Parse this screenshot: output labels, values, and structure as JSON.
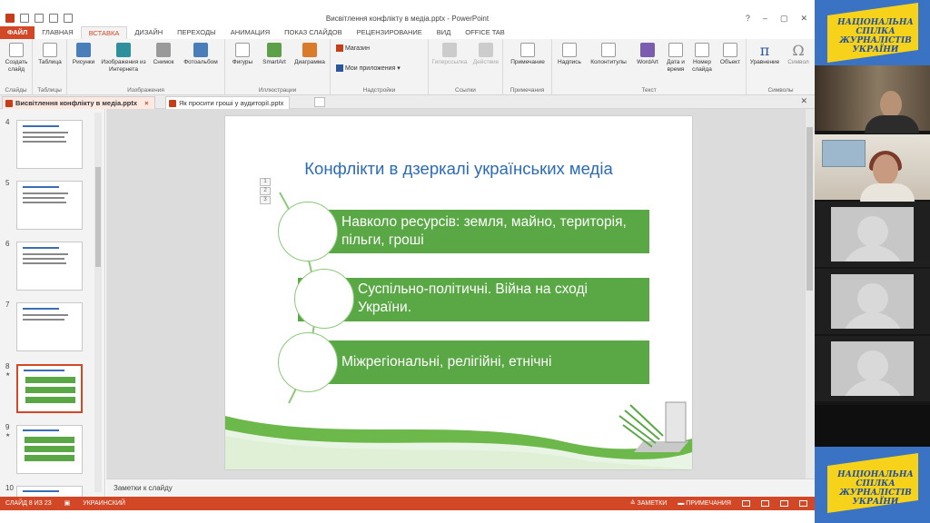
{
  "window": {
    "title": "Висвітлення конфлікту в медіа.pptx - PowerPoint"
  },
  "ribbon_tabs": [
    {
      "label": "ФАЙЛ"
    },
    {
      "label": "ГЛАВНАЯ"
    },
    {
      "label": "ВСТАВКА"
    },
    {
      "label": "ДИЗАЙН"
    },
    {
      "label": "ПЕРЕХОДЫ"
    },
    {
      "label": "АНИМАЦИЯ"
    },
    {
      "label": "ПОКАЗ СЛАЙДОВ"
    },
    {
      "label": "РЕЦЕНЗИРОВАНИЕ"
    },
    {
      "label": "ВИД"
    },
    {
      "label": "OFFICE TAB"
    }
  ],
  "ribbon": {
    "new_slide": "Создать слайд",
    "table": "Таблица",
    "pictures": "Рисунки",
    "online_pictures": "Изображения из Интернета",
    "screenshot": "Снимок",
    "photo_album": "Фотоальбом",
    "shapes": "Фигуры",
    "smartart": "SmartArt",
    "chart": "Диаграмма",
    "store": "Магазин",
    "my_apps": "Мои приложения",
    "hyperlink": "Гиперссылка",
    "action": "Действие",
    "comment": "Примечание",
    "textbox": "Надпись",
    "header_footer": "Колонтитулы",
    "wordart": "WordArt",
    "date_time": "Дата и время",
    "slide_number": "Номер слайда",
    "object": "Объект",
    "equation": "Уравнение",
    "symbol": "Символ",
    "groups": {
      "slides": "Слайды",
      "tables": "Таблицы",
      "images": "Изображения",
      "illustrations": "Иллюстрации",
      "addins": "Надстройки",
      "links": "Ссылки",
      "comments": "Примечания",
      "text": "Текст",
      "symbols": "Символы"
    }
  },
  "doc_tabs": [
    {
      "label": "Висвітлення конфлікту в медіа.pptx"
    },
    {
      "label": "Як просити гроші у аудиторії.pptx"
    }
  ],
  "thumbnails": [
    {
      "number": "4"
    },
    {
      "number": "5"
    },
    {
      "number": "6"
    },
    {
      "number": "7"
    },
    {
      "number": "8"
    },
    {
      "number": "9"
    },
    {
      "number": "10"
    }
  ],
  "slide": {
    "title": "Конфлікти в дзеркалі українських медіа",
    "items": [
      {
        "text": "Навколо ресурсів: земля, майно, територія, пільги, гроші"
      },
      {
        "text": "Суспільно-політичні. Війна на сході України."
      },
      {
        "text": "Міжрегіональні, релігійні, етнічні"
      }
    ],
    "colors": {
      "title": "#2a6ab8",
      "accent": "#5aa845"
    }
  },
  "notes": {
    "placeholder": "Заметки к слайду"
  },
  "status": {
    "slide_info": "СЛАЙД 8 ИЗ 23",
    "language": "УКРАИНСКИЙ",
    "notes_btn": "ЗАМЕТКИ",
    "comments_btn": "ПРИМЕЧАНИЯ"
  },
  "video_gallery": {
    "logo_text": "НАЦІОНАЛЬНА СПІЛКА ЖУРНАЛІСТІВ УКРАЇНИ"
  },
  "colors": {
    "brand": "#d24726",
    "logo_blue": "#3b73c4",
    "logo_yellow": "#f7d21b"
  }
}
